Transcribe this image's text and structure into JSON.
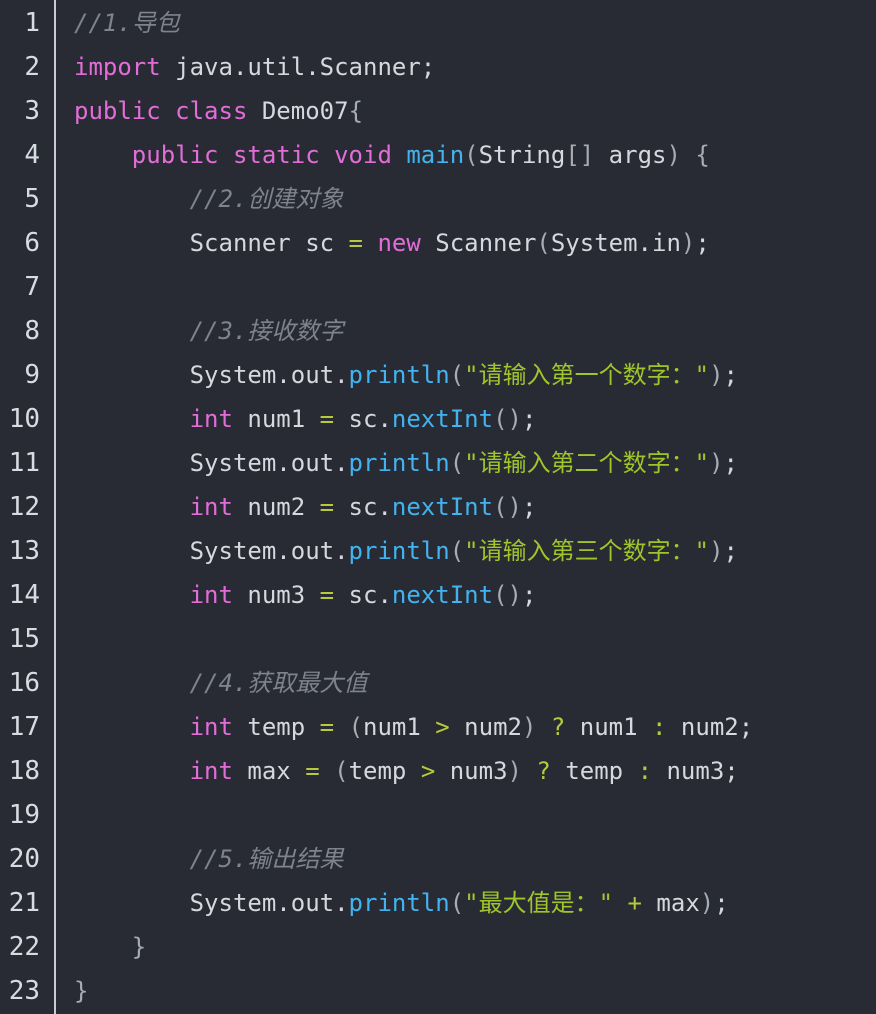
{
  "editor": {
    "language": "java",
    "colors": {
      "background": "#282b34",
      "keyword": "#e36dd8",
      "function": "#43b3f0",
      "string": "#9fc52a",
      "operator": "#b7c93c",
      "comment": "#7e838c",
      "text": "#d5d8de"
    },
    "lines": [
      {
        "n": "1",
        "tokens": [
          {
            "t": "//1.导包",
            "c": "cm"
          }
        ]
      },
      {
        "n": "2",
        "tokens": [
          {
            "t": "import",
            "c": "kw"
          },
          {
            "t": " java.util.Scanner;",
            "c": ""
          }
        ]
      },
      {
        "n": "3",
        "tokens": [
          {
            "t": "public",
            "c": "kw"
          },
          {
            "t": " ",
            "c": ""
          },
          {
            "t": "class",
            "c": "kw"
          },
          {
            "t": " Demo07",
            "c": ""
          },
          {
            "t": "{",
            "c": "pn"
          }
        ]
      },
      {
        "n": "4",
        "tokens": [
          {
            "t": "    ",
            "c": ""
          },
          {
            "t": "public",
            "c": "kw"
          },
          {
            "t": " ",
            "c": ""
          },
          {
            "t": "static",
            "c": "kw"
          },
          {
            "t": " ",
            "c": ""
          },
          {
            "t": "void",
            "c": "kw"
          },
          {
            "t": " ",
            "c": ""
          },
          {
            "t": "main",
            "c": "fn"
          },
          {
            "t": "(",
            "c": "pn"
          },
          {
            "t": "String",
            "c": ""
          },
          {
            "t": "[]",
            "c": "pn"
          },
          {
            "t": " args",
            "c": ""
          },
          {
            "t": ")",
            "c": "pn"
          },
          {
            "t": " ",
            "c": ""
          },
          {
            "t": "{",
            "c": "pn"
          }
        ]
      },
      {
        "n": "5",
        "tokens": [
          {
            "t": "        ",
            "c": ""
          },
          {
            "t": "//2.创建对象",
            "c": "cm"
          }
        ]
      },
      {
        "n": "6",
        "tokens": [
          {
            "t": "        Scanner sc ",
            "c": ""
          },
          {
            "t": "=",
            "c": "op"
          },
          {
            "t": " ",
            "c": ""
          },
          {
            "t": "new",
            "c": "kw"
          },
          {
            "t": " Scanner",
            "c": ""
          },
          {
            "t": "(",
            "c": "pn"
          },
          {
            "t": "System.in",
            "c": ""
          },
          {
            "t": ")",
            "c": "pn"
          },
          {
            "t": ";",
            "c": ""
          }
        ]
      },
      {
        "n": "7",
        "tokens": []
      },
      {
        "n": "8",
        "tokens": [
          {
            "t": "        ",
            "c": ""
          },
          {
            "t": "//3.接收数字",
            "c": "cm"
          }
        ]
      },
      {
        "n": "9",
        "tokens": [
          {
            "t": "        System.out.",
            "c": ""
          },
          {
            "t": "println",
            "c": "fn"
          },
          {
            "t": "(",
            "c": "pn"
          },
          {
            "t": "\"请输入第一个数字：\"",
            "c": "str"
          },
          {
            "t": ")",
            "c": "pn"
          },
          {
            "t": ";",
            "c": ""
          }
        ]
      },
      {
        "n": "10",
        "tokens": [
          {
            "t": "        ",
            "c": ""
          },
          {
            "t": "int",
            "c": "kw"
          },
          {
            "t": " num1 ",
            "c": ""
          },
          {
            "t": "=",
            "c": "op"
          },
          {
            "t": " sc.",
            "c": ""
          },
          {
            "t": "nextInt",
            "c": "fn"
          },
          {
            "t": "()",
            "c": "pn"
          },
          {
            "t": ";",
            "c": ""
          }
        ]
      },
      {
        "n": "11",
        "tokens": [
          {
            "t": "        System.out.",
            "c": ""
          },
          {
            "t": "println",
            "c": "fn"
          },
          {
            "t": "(",
            "c": "pn"
          },
          {
            "t": "\"请输入第二个数字：\"",
            "c": "str"
          },
          {
            "t": ")",
            "c": "pn"
          },
          {
            "t": ";",
            "c": ""
          }
        ]
      },
      {
        "n": "12",
        "tokens": [
          {
            "t": "        ",
            "c": ""
          },
          {
            "t": "int",
            "c": "kw"
          },
          {
            "t": " num2 ",
            "c": ""
          },
          {
            "t": "=",
            "c": "op"
          },
          {
            "t": " sc.",
            "c": ""
          },
          {
            "t": "nextInt",
            "c": "fn"
          },
          {
            "t": "()",
            "c": "pn"
          },
          {
            "t": ";",
            "c": ""
          }
        ]
      },
      {
        "n": "13",
        "tokens": [
          {
            "t": "        System.out.",
            "c": ""
          },
          {
            "t": "println",
            "c": "fn"
          },
          {
            "t": "(",
            "c": "pn"
          },
          {
            "t": "\"请输入第三个数字：\"",
            "c": "str"
          },
          {
            "t": ")",
            "c": "pn"
          },
          {
            "t": ";",
            "c": ""
          }
        ]
      },
      {
        "n": "14",
        "tokens": [
          {
            "t": "        ",
            "c": ""
          },
          {
            "t": "int",
            "c": "kw"
          },
          {
            "t": " num3 ",
            "c": ""
          },
          {
            "t": "=",
            "c": "op"
          },
          {
            "t": " sc.",
            "c": ""
          },
          {
            "t": "nextInt",
            "c": "fn"
          },
          {
            "t": "()",
            "c": "pn"
          },
          {
            "t": ";",
            "c": ""
          }
        ]
      },
      {
        "n": "15",
        "tokens": []
      },
      {
        "n": "16",
        "tokens": [
          {
            "t": "        ",
            "c": ""
          },
          {
            "t": "//4.获取最大值",
            "c": "cm"
          }
        ]
      },
      {
        "n": "17",
        "tokens": [
          {
            "t": "        ",
            "c": ""
          },
          {
            "t": "int",
            "c": "kw"
          },
          {
            "t": " temp ",
            "c": ""
          },
          {
            "t": "=",
            "c": "op"
          },
          {
            "t": " ",
            "c": ""
          },
          {
            "t": "(",
            "c": "pn"
          },
          {
            "t": "num1 ",
            "c": ""
          },
          {
            "t": ">",
            "c": "op"
          },
          {
            "t": " num2",
            "c": ""
          },
          {
            "t": ")",
            "c": "pn"
          },
          {
            "t": " ",
            "c": ""
          },
          {
            "t": "?",
            "c": "op"
          },
          {
            "t": " num1 ",
            "c": ""
          },
          {
            "t": ":",
            "c": "op"
          },
          {
            "t": " num2;",
            "c": ""
          }
        ]
      },
      {
        "n": "18",
        "tokens": [
          {
            "t": "        ",
            "c": ""
          },
          {
            "t": "int",
            "c": "kw"
          },
          {
            "t": " max ",
            "c": ""
          },
          {
            "t": "=",
            "c": "op"
          },
          {
            "t": " ",
            "c": ""
          },
          {
            "t": "(",
            "c": "pn"
          },
          {
            "t": "temp ",
            "c": ""
          },
          {
            "t": ">",
            "c": "op"
          },
          {
            "t": " num3",
            "c": ""
          },
          {
            "t": ")",
            "c": "pn"
          },
          {
            "t": " ",
            "c": ""
          },
          {
            "t": "?",
            "c": "op"
          },
          {
            "t": " temp ",
            "c": ""
          },
          {
            "t": ":",
            "c": "op"
          },
          {
            "t": " num3;",
            "c": ""
          }
        ]
      },
      {
        "n": "19",
        "tokens": []
      },
      {
        "n": "20",
        "tokens": [
          {
            "t": "        ",
            "c": ""
          },
          {
            "t": "//5.输出结果",
            "c": "cm"
          }
        ]
      },
      {
        "n": "21",
        "tokens": [
          {
            "t": "        System.out.",
            "c": ""
          },
          {
            "t": "println",
            "c": "fn"
          },
          {
            "t": "(",
            "c": "pn"
          },
          {
            "t": "\"最大值是：\"",
            "c": "str"
          },
          {
            "t": " ",
            "c": ""
          },
          {
            "t": "+",
            "c": "op"
          },
          {
            "t": " max",
            "c": ""
          },
          {
            "t": ")",
            "c": "pn"
          },
          {
            "t": ";",
            "c": ""
          }
        ]
      },
      {
        "n": "22",
        "tokens": [
          {
            "t": "    ",
            "c": ""
          },
          {
            "t": "}",
            "c": "pn"
          }
        ]
      },
      {
        "n": "23",
        "tokens": [
          {
            "t": "}",
            "c": "pn"
          }
        ]
      }
    ]
  }
}
